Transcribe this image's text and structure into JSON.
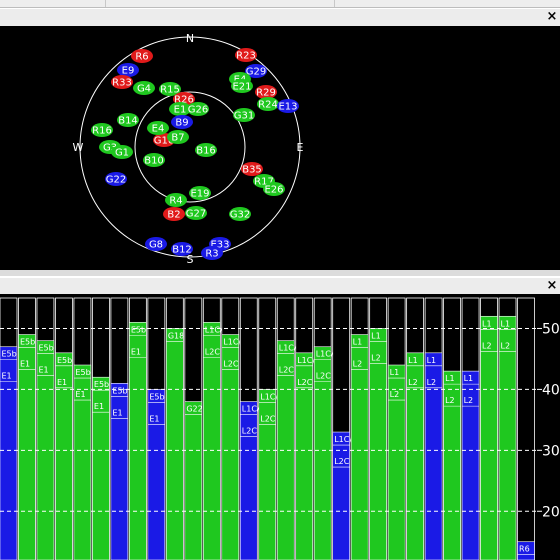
{
  "window": {
    "close_label": "×"
  },
  "skyview": {
    "compass": {
      "n": "N",
      "s": "S",
      "e": "E",
      "w": "W"
    },
    "colors": {
      "G": "#1fc81f",
      "E": "#1fc81f",
      "R": "#e01a1a",
      "B": "#1a1ae6"
    },
    "satellites": [
      {
        "label": "R6",
        "sys": "R"
      },
      {
        "label": "E9",
        "sys": "B"
      },
      {
        "label": "R33",
        "sys": "R"
      },
      {
        "label": "G4",
        "sys": "G"
      },
      {
        "label": "R15",
        "sys": "G"
      },
      {
        "label": "R26",
        "sys": "R"
      },
      {
        "label": "E1",
        "sys": "G"
      },
      {
        "label": "G26",
        "sys": "G"
      },
      {
        "label": "B9",
        "sys": "B"
      },
      {
        "label": "R23",
        "sys": "R"
      },
      {
        "label": "G29",
        "sys": "B"
      },
      {
        "label": "E4",
        "sys": "G"
      },
      {
        "label": "E21",
        "sys": "G"
      },
      {
        "label": "R29",
        "sys": "R"
      },
      {
        "label": "R24",
        "sys": "G"
      },
      {
        "label": "E13",
        "sys": "B"
      },
      {
        "label": "G31",
        "sys": "G"
      },
      {
        "label": "B14",
        "sys": "G"
      },
      {
        "label": "R16",
        "sys": "G"
      },
      {
        "label": "G16",
        "sys": "R"
      },
      {
        "label": "E4",
        "sys": "G"
      },
      {
        "label": "B7",
        "sys": "G"
      },
      {
        "label": "G3",
        "sys": "G"
      },
      {
        "label": "G1",
        "sys": "G"
      },
      {
        "label": "B16",
        "sys": "G"
      },
      {
        "label": "B10",
        "sys": "G"
      },
      {
        "label": "G22",
        "sys": "B"
      },
      {
        "label": "B35",
        "sys": "R"
      },
      {
        "label": "R17",
        "sys": "G"
      },
      {
        "label": "E26",
        "sys": "G"
      },
      {
        "label": "E19",
        "sys": "G"
      },
      {
        "label": "R4",
        "sys": "G"
      },
      {
        "label": "B2",
        "sys": "R"
      },
      {
        "label": "G27",
        "sys": "G"
      },
      {
        "label": "G32",
        "sys": "G"
      },
      {
        "label": "G8",
        "sys": "B"
      },
      {
        "label": "B12",
        "sys": "B"
      },
      {
        "label": "E33",
        "sys": "B"
      },
      {
        "label": "R3",
        "sys": "B"
      }
    ]
  },
  "snr": {
    "axis": {
      "ticks": [
        "50",
        "40",
        "30",
        "20"
      ],
      "ymin": 12,
      "ymax": 55
    },
    "colors": {
      "G": "#1fc81f",
      "B": "#1a1ae6",
      "bg": "#000000",
      "grid": "#ffffff"
    },
    "channels": [
      {
        "fill": "B",
        "v": 47,
        "labels": [
          "E5b",
          "E1"
        ]
      },
      {
        "fill": "G",
        "v": 49,
        "labels": [
          "E5b",
          "E1"
        ]
      },
      {
        "fill": "G",
        "v": 48,
        "labels": [
          "E5b",
          "E1"
        ]
      },
      {
        "fill": "G",
        "v": 46,
        "labels": [
          "E5b",
          "E1"
        ]
      },
      {
        "fill": "G",
        "v": 44,
        "labels": [
          "E5b",
          "E1"
        ]
      },
      {
        "fill": "G",
        "v": 42,
        "labels": [
          "E5b",
          "E1"
        ]
      },
      {
        "fill": "B",
        "v": 41,
        "labels": [
          "E5b",
          "E1"
        ]
      },
      {
        "fill": "G",
        "v": 51,
        "labels": [
          "E5b",
          "E1"
        ]
      },
      {
        "fill": "B",
        "v": 40,
        "labels": [
          "E5b",
          "E1"
        ]
      },
      {
        "fill": "G",
        "v": 50,
        "labels": [
          "G18"
        ]
      },
      {
        "fill": "G",
        "v": 38,
        "labels": [
          "G22"
        ]
      },
      {
        "fill": "G",
        "v": 51,
        "labels": [
          "L1C/A",
          "L2C"
        ]
      },
      {
        "fill": "G",
        "v": 49,
        "labels": [
          "L1C/A",
          "L2C"
        ]
      },
      {
        "fill": "B",
        "v": 38,
        "labels": [
          "L1C/A",
          "L2C"
        ]
      },
      {
        "fill": "G",
        "v": 40,
        "labels": [
          "L1C/A",
          "L2C"
        ]
      },
      {
        "fill": "G",
        "v": 48,
        "labels": [
          "L1C/A",
          "L2C"
        ]
      },
      {
        "fill": "G",
        "v": 46,
        "labels": [
          "L1C/A",
          "L2C"
        ]
      },
      {
        "fill": "G",
        "v": 47,
        "labels": [
          "L1C/A",
          "L2C"
        ]
      },
      {
        "fill": "B",
        "v": 33,
        "labels": [
          "L1C/A",
          "L2C"
        ]
      },
      {
        "fill": "G",
        "v": 49,
        "labels": [
          "L1",
          "L2"
        ]
      },
      {
        "fill": "G",
        "v": 50,
        "labels": [
          "L1",
          "L2"
        ]
      },
      {
        "fill": "G",
        "v": 44,
        "labels": [
          "L1",
          "L2"
        ]
      },
      {
        "fill": "G",
        "v": 46,
        "labels": [
          "L1",
          "L2"
        ]
      },
      {
        "fill": "B",
        "v": 46,
        "labels": [
          "L1",
          "L2"
        ]
      },
      {
        "fill": "G",
        "v": 43,
        "labels": [
          "L1",
          "L2"
        ]
      },
      {
        "fill": "B",
        "v": 43,
        "labels": [
          "L1",
          "L2"
        ]
      },
      {
        "fill": "G",
        "v": 52,
        "labels": [
          "L1",
          "L2"
        ]
      },
      {
        "fill": "G",
        "v": 52,
        "labels": [
          "L1",
          "L2"
        ]
      },
      {
        "fill": "B",
        "v": 15,
        "labels": [
          "R6"
        ]
      }
    ]
  }
}
